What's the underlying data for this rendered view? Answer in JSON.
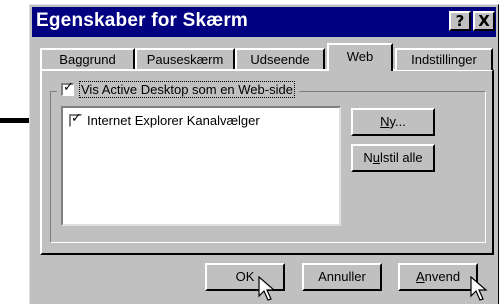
{
  "window": {
    "title": "Egenskaber for Skærm",
    "help_label": "?",
    "close_label": "X"
  },
  "tabs": [
    {
      "label": "Baggrund"
    },
    {
      "label": "Pauseskærm"
    },
    {
      "label": "Udseende"
    },
    {
      "label": "Web"
    },
    {
      "label": "Indstillinger"
    }
  ],
  "group": {
    "checkbox_label": "Vis Active Desktop som en Web-side",
    "checked": true
  },
  "list": {
    "items": [
      {
        "label": "Internet Explorer Kanalvælger",
        "checked": true
      }
    ]
  },
  "buttons": {
    "new_label_u": "N",
    "new_label_rest": "y...",
    "reset_label_pre": "N",
    "reset_label_u": "u",
    "reset_label_rest": "lstil alle",
    "ok_label": "OK",
    "cancel_label": "Annuller",
    "apply_label_u": "A",
    "apply_label_rest": "nvend"
  },
  "icons": {
    "pointer_arrow": "arrow-right-icon",
    "mouse_cursor": "mouse-cursor-icon"
  },
  "colors": {
    "titlebar": "#000080",
    "face": "#c0c0c0"
  }
}
